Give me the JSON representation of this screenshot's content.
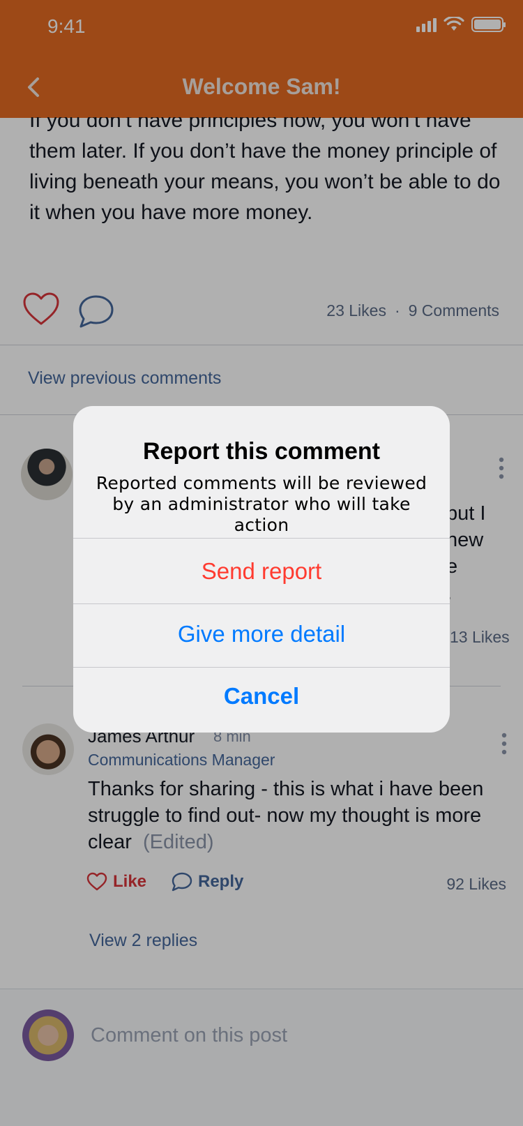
{
  "status_bar": {
    "time": "9:41"
  },
  "header": {
    "title": "Welcome Sam!"
  },
  "post": {
    "text": "If you don’t have principles now, you won’t have them later. If you don’t have the money principle of living beneath your means, you won’t be able to do it when you have more money.",
    "likes": "23 Likes",
    "separator": "·",
    "comments": "9 Comments"
  },
  "comments_section": {
    "view_previous": "View previous comments",
    "comment1": {
      "partial_lines": [
        "but I",
        "new",
        "e",
        "."
      ],
      "likes": "13 Likes"
    },
    "comment2": {
      "name": "James Arthur",
      "time": "8 min",
      "role": "Communications Manager",
      "text": "Thanks for sharing - this is what i have been struggle to find out- now my thought is more clear",
      "edited": "(Edited)",
      "like_label": "Like",
      "reply_label": "Reply",
      "likes": "92 Likes",
      "view_replies": "View 2 replies"
    }
  },
  "composer": {
    "placeholder": "Comment on this post"
  },
  "dialog": {
    "title": "Report this comment",
    "message": "Reported comments will be reviewed by an administrator who will take action",
    "send_report": "Send report",
    "give_more_detail": "Give more detail",
    "cancel": "Cancel"
  },
  "colors": {
    "header": "#e46a22",
    "destructive": "#ff3b30",
    "action": "#007aff",
    "link": "#45679b"
  }
}
